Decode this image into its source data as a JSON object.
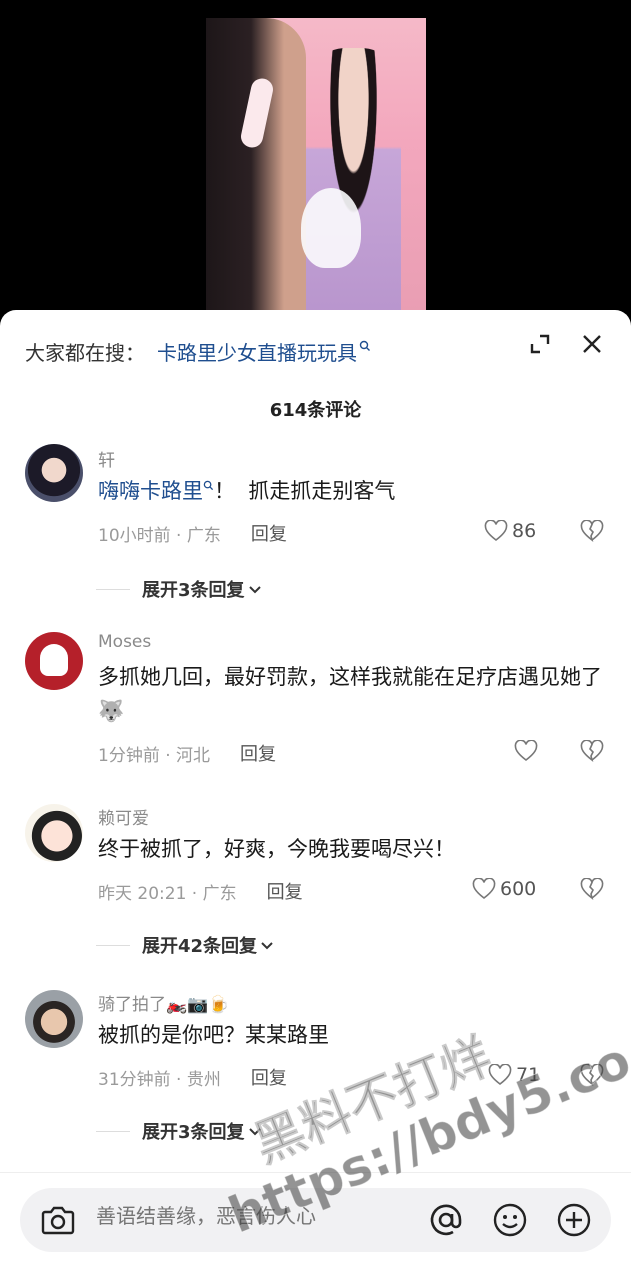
{
  "search": {
    "prefix": "大家都在搜：",
    "term": "卡路里少女直播玩玩具"
  },
  "header": {
    "comment_count": "614条评论"
  },
  "comments": [
    {
      "username": "轩",
      "text_link": "嗨嗨卡路里",
      "text_rest": "！  抓走抓走别客气",
      "time_location": "10小时前 · 广东",
      "reply": "回复",
      "likes": "86",
      "expand": "展开3条回复"
    },
    {
      "username": "Moses",
      "text": "多抓她几回，最好罚款，这样我就能在足疗店遇见她了🐺",
      "time_location": "1分钟前 · 河北",
      "reply": "回复",
      "likes": ""
    },
    {
      "username": "赖可爱",
      "text": "终于被抓了，好爽，今晚我要喝尽兴！",
      "time_location": "昨天 20:21 · 广东",
      "reply": "回复",
      "likes": "600",
      "expand": "展开42条回复"
    },
    {
      "username": "骑了拍了🏍️📷🍺",
      "text": "被抓的是你吧？某某路里",
      "time_location": "31分钟前 · 贵州",
      "reply": "回复",
      "likes": "71",
      "expand": "展开3条回复"
    }
  ],
  "input": {
    "placeholder": "善语结善缘，恶言伤人心"
  },
  "watermark": {
    "line1": "黑料不打烊",
    "line2": "https://bdy5.co"
  },
  "icons": {
    "search": "search-icon",
    "expand": "expand-icon",
    "close": "close-icon",
    "like": "heart-icon",
    "dislike": "broken-heart-icon",
    "camera": "camera-icon",
    "at": "at-icon",
    "emoji": "emoji-icon",
    "plus": "plus-icon"
  },
  "colors": {
    "link": "#1f4e8f",
    "sheet": "#ffffff",
    "input_bg": "#f1f1f3"
  }
}
